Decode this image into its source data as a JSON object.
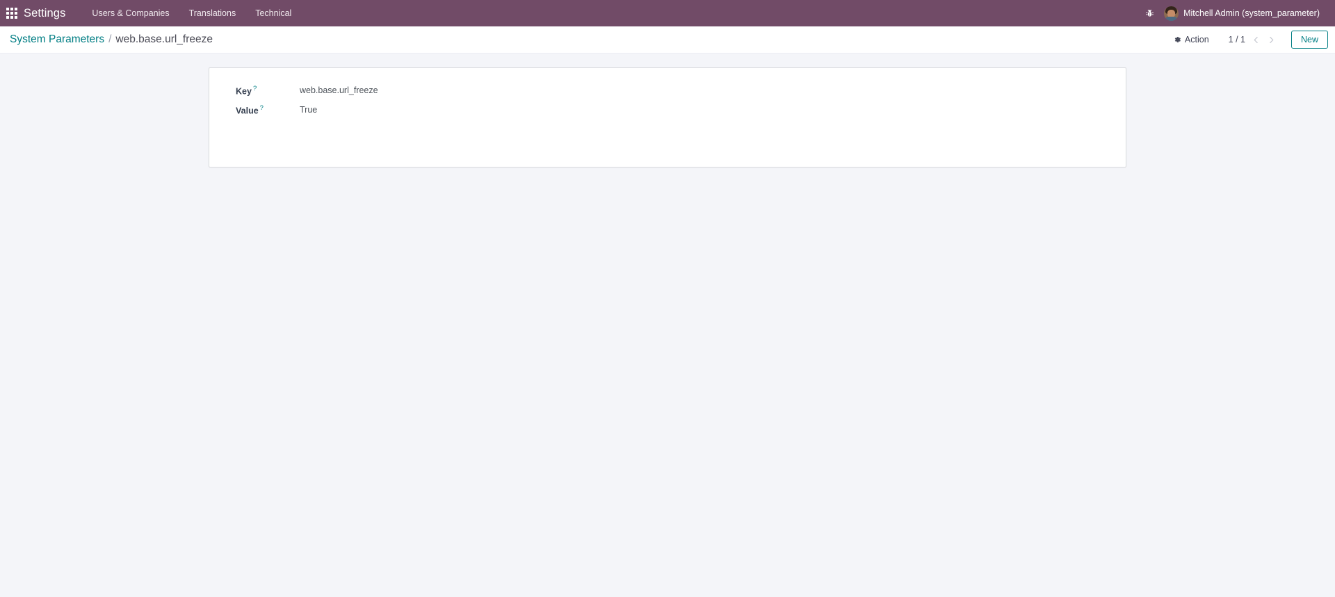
{
  "navbar": {
    "apps_icon": "apps-grid-icon",
    "brand": "Settings",
    "menu_items": [
      {
        "label": "Users & Companies"
      },
      {
        "label": "Translations"
      },
      {
        "label": "Technical"
      }
    ],
    "debug_icon": "bug-icon",
    "user_name": "Mitchell Admin (system_parameter)",
    "background_color": "#714B67"
  },
  "control_panel": {
    "breadcrumb": {
      "parent": "System Parameters",
      "separator": "/",
      "current": "web.base.url_freeze"
    },
    "action_button": {
      "label": "Action",
      "icon": "gear-icon"
    },
    "pager": {
      "value": "1 / 1",
      "previous_icon": "chevron-left-icon",
      "next_icon": "chevron-right-icon"
    },
    "new_button": {
      "label": "New",
      "accent_color": "#017e84"
    }
  },
  "form": {
    "fields": [
      {
        "label": "Key",
        "help_marker": "?",
        "value": "web.base.url_freeze"
      },
      {
        "label": "Value",
        "help_marker": "?",
        "value": "True"
      }
    ]
  },
  "colors": {
    "brand_purple": "#714B67",
    "accent_teal": "#017e84",
    "page_background": "#f4f5f9",
    "sheet_background": "#ffffff",
    "sheet_border": "#d8dadd"
  }
}
